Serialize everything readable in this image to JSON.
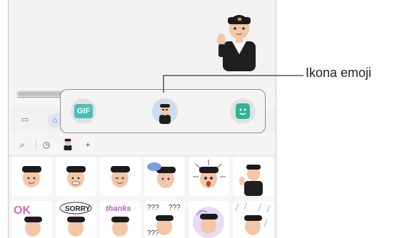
{
  "callout_label": "Ikona emoji",
  "toolbar": {
    "gif_label": "GIF",
    "buttons": [
      "gif",
      "emoji",
      "sticker"
    ]
  },
  "search_row": {
    "icons": [
      "search-icon",
      "clock-icon",
      "avatar-icon",
      "plus-icon"
    ]
  },
  "sticker_grid": {
    "row1": [
      "sticker-smile",
      "sticker-grin",
      "sticker-wink",
      "sticker-ok",
      "sticker-shock",
      "sticker-wave"
    ],
    "row2": [
      "sticker-ok-text",
      "sticker-sorry",
      "sticker-thanks",
      "sticker-question",
      "sticker-swirl",
      "sticker-rain"
    ],
    "texts": {
      "ok": "OK",
      "sorry": "SORRY",
      "thanks": "thanks",
      "question": "???"
    }
  },
  "colors": {
    "accent": "#2f6ec7",
    "gif": "#4bbfb4",
    "sticker": "#2fb394",
    "cap": "#1b1b1b",
    "skin": "#f2c7a8"
  }
}
